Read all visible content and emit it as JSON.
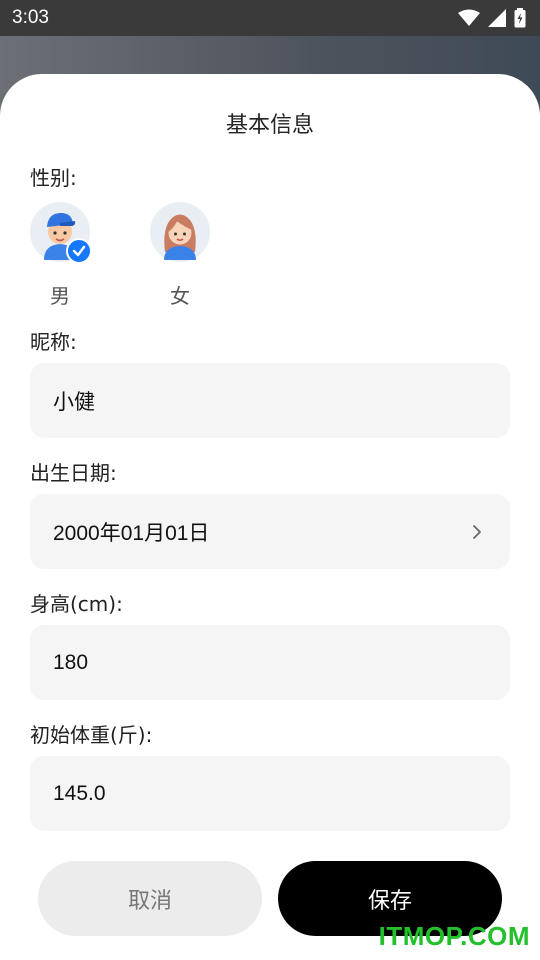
{
  "status_bar": {
    "time": "3:03"
  },
  "sheet": {
    "title": "基本信息",
    "gender": {
      "label": "性别:",
      "options": [
        {
          "label": "男",
          "selected": true
        },
        {
          "label": "女",
          "selected": false
        }
      ]
    },
    "nickname": {
      "label": "昵称:",
      "value": "小健"
    },
    "birthdate": {
      "label": "出生日期:",
      "value": "2000年01月01日"
    },
    "height": {
      "label": "身高(cm):",
      "value": "180"
    },
    "weight": {
      "label": "初始体重(斤):",
      "value": "145.0"
    },
    "buttons": {
      "cancel": "取消",
      "save": "保存"
    }
  },
  "watermark": "ITMOP.COM",
  "colors": {
    "accent": "#1677ff",
    "save_bg": "#000000",
    "watermark": "#22c02a"
  }
}
